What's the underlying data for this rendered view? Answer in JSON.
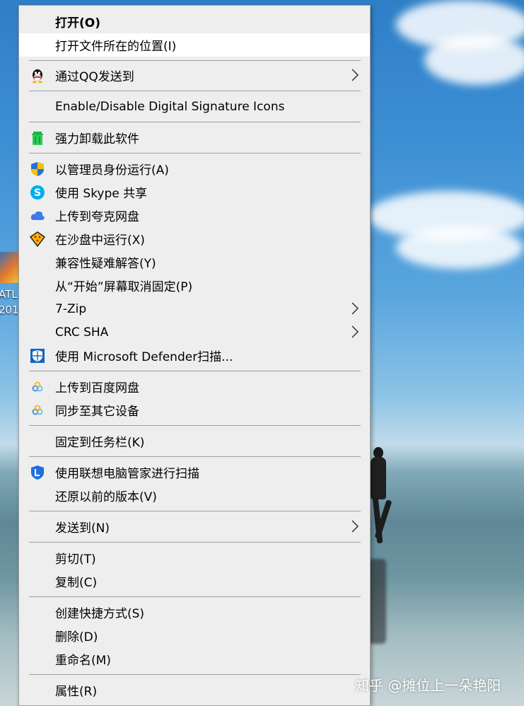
{
  "menu": {
    "items": [
      {
        "label": "打开(O)",
        "icon": null,
        "submenu": false
      },
      {
        "label": "打开文件所在的位置(I)",
        "icon": null,
        "submenu": false
      },
      {
        "label": "通过QQ发送到",
        "icon": "qq-penguin-icon",
        "submenu": true
      },
      {
        "label": "Enable/Disable Digital Signature Icons",
        "icon": null,
        "submenu": false
      },
      {
        "label": "强力卸载此软件",
        "icon": "trash-can-icon",
        "submenu": false
      },
      {
        "label": "以管理员身份运行(A)",
        "icon": "uac-shield-icon",
        "submenu": false
      },
      {
        "label": "使用 Skype 共享",
        "icon": "skype-icon",
        "submenu": false
      },
      {
        "label": "上传到夸克网盘",
        "icon": "cloud-icon",
        "submenu": false
      },
      {
        "label": "在沙盘中运行(X)",
        "icon": "sandbox-icon",
        "submenu": false
      },
      {
        "label": "兼容性疑难解答(Y)",
        "icon": null,
        "submenu": false
      },
      {
        "label": "从“开始”屏幕取消固定(P)",
        "icon": null,
        "submenu": false
      },
      {
        "label": "7-Zip",
        "icon": null,
        "submenu": true
      },
      {
        "label": "CRC SHA",
        "icon": null,
        "submenu": true
      },
      {
        "label": "使用 Microsoft Defender扫描...",
        "icon": "defender-shield-icon",
        "submenu": false
      },
      {
        "label": "上传到百度网盘",
        "icon": "baidu-netdisk-icon",
        "submenu": false
      },
      {
        "label": "同步至其它设备",
        "icon": "baidu-netdisk-icon",
        "submenu": false
      },
      {
        "label": "固定到任务栏(K)",
        "icon": null,
        "submenu": false
      },
      {
        "label": "使用联想电脑管家进行扫描",
        "icon": "lenovo-shield-icon",
        "submenu": false
      },
      {
        "label": "还原以前的版本(V)",
        "icon": null,
        "submenu": false
      },
      {
        "label": "发送到(N)",
        "icon": null,
        "submenu": true
      },
      {
        "label": "剪切(T)",
        "icon": null,
        "submenu": false
      },
      {
        "label": "复制(C)",
        "icon": null,
        "submenu": false
      },
      {
        "label": "创建快捷方式(S)",
        "icon": null,
        "submenu": false
      },
      {
        "label": "删除(D)",
        "icon": null,
        "submenu": false
      },
      {
        "label": "重命名(M)",
        "icon": null,
        "submenu": false
      },
      {
        "label": "属性(R)",
        "icon": null,
        "submenu": false
      }
    ]
  },
  "desktop": {
    "icon_label_line1": "ATL",
    "icon_label_line2": "201"
  },
  "watermark": "知乎 @摊位上一朵艳阳",
  "colors": {
    "menu_bg": "#eeeeee",
    "hover_bg": "#ffffff",
    "separator": "#a0a0a0"
  }
}
